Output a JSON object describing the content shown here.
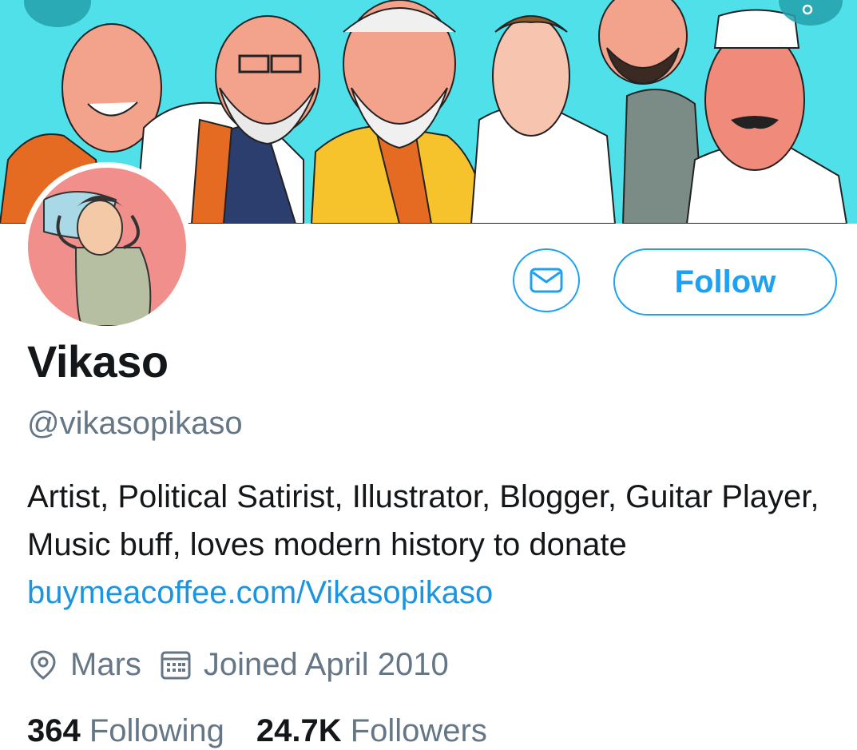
{
  "profile": {
    "name": "Vikaso",
    "handle": "@vikasopikaso",
    "bio_text": "Artist, Political Satirist, Illustrator, Blogger, Guitar Player, Music buff, loves modern history  to donate ",
    "bio_link": "buymeacoffee.com/Vikasopikaso",
    "location": "Mars",
    "joined": "Joined April 2010",
    "following_count": "364",
    "following_label": "Following",
    "followers_count": "24.7K",
    "followers_label": "Followers"
  },
  "actions": {
    "follow_label": "Follow",
    "message_icon": "envelope-icon"
  },
  "nav": {
    "back_icon": "back-arrow-icon",
    "more_icon": "more-icon"
  },
  "colors": {
    "accent": "#1da1f2",
    "link": "#1b95e0",
    "secondary_text": "#657786",
    "banner_bg": "#4fe0ea",
    "avatar_bg": "#f08f8c"
  }
}
